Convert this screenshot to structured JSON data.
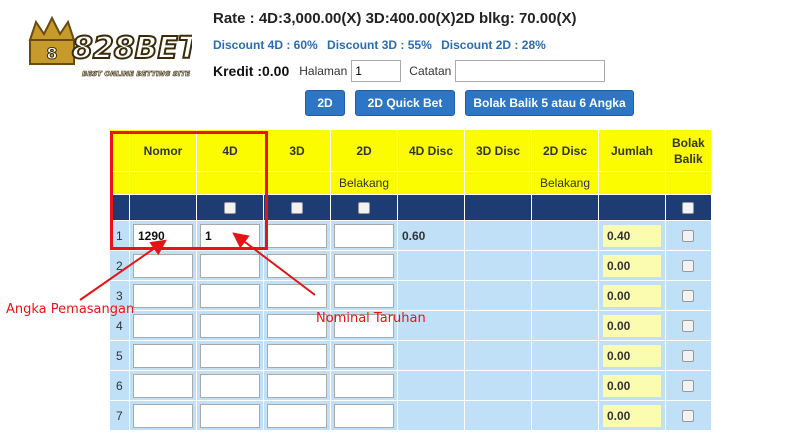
{
  "logo": {
    "text": "828BET",
    "tagline": "BEST ONLINE BETTING SITE"
  },
  "header": {
    "rate": "Rate : 4D:3,000.00(X) 3D:400.00(X)2D blkg: 70.00(X)",
    "discounts": [
      "Discount 4D : 60%",
      "Discount 3D : 55%",
      "Discount 2D : 28%"
    ],
    "kredit": "Kredit :0.00",
    "halaman_label": "Halaman",
    "halaman_value": "1",
    "catatan_label": "Catatan",
    "catatan_value": ""
  },
  "buttons": {
    "b2d": "2D",
    "b2dq": "2D Quick Bet",
    "bolak": "Bolak Balik 5 atau 6 Angka"
  },
  "table": {
    "headers": [
      "Nomor",
      "4D",
      "3D",
      "2D",
      "4D Disc",
      "3D Disc",
      "2D Disc",
      "Jumlah",
      "Bolak Balik"
    ],
    "sub": [
      "Belakang",
      "Belakang"
    ],
    "rows": [
      {
        "num": "1",
        "nomor": "1290",
        "d4": "1",
        "disc": "0.60",
        "jumlah": "0.40"
      },
      {
        "num": "2",
        "nomor": "",
        "d4": "",
        "disc": "",
        "jumlah": "0.00"
      },
      {
        "num": "3",
        "nomor": "",
        "d4": "",
        "disc": "",
        "jumlah": "0.00"
      },
      {
        "num": "4",
        "nomor": "",
        "d4": "",
        "disc": "",
        "jumlah": "0.00"
      },
      {
        "num": "5",
        "nomor": "",
        "d4": "",
        "disc": "",
        "jumlah": "0.00"
      },
      {
        "num": "6",
        "nomor": "",
        "d4": "",
        "disc": "",
        "jumlah": "0.00"
      },
      {
        "num": "7",
        "nomor": "",
        "d4": "",
        "disc": "",
        "jumlah": "0.00"
      }
    ]
  },
  "annotations": {
    "angka": "Angka Pemasangan",
    "nominal": "Nominal Taruhan"
  },
  "colors": {
    "accent_blue": "#2c76c5",
    "header_yellow": "#fcfc00",
    "row_blue": "#bfe0f7",
    "dark_navy": "#1c3c73",
    "annotation_red": "#e51515"
  }
}
